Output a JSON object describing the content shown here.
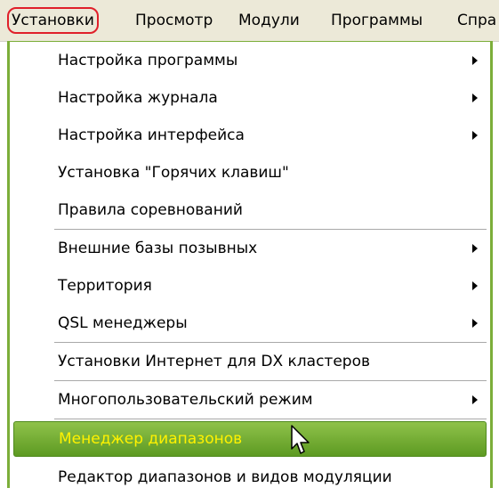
{
  "menubar": {
    "items": [
      {
        "label": "Установки",
        "active": true
      },
      {
        "label": "Просмотр"
      },
      {
        "label": "Модули"
      },
      {
        "label": "Программы"
      },
      {
        "label": "Спра"
      }
    ]
  },
  "menu": {
    "items": [
      {
        "label": "Настройка программы",
        "submenu": true
      },
      {
        "label": "Настройка журнала",
        "submenu": true
      },
      {
        "label": "Настройка интерфейса",
        "submenu": true
      },
      {
        "label": "Установка \"Горячих клавиш\"",
        "submenu": false
      },
      {
        "label": "Правила соревнований",
        "submenu": false
      },
      {
        "label": "Внешние базы позывных",
        "submenu": true
      },
      {
        "label": "Территория",
        "submenu": true
      },
      {
        "label": "QSL менеджеры",
        "submenu": true
      },
      {
        "label": "Установки Интернет для DX кластеров",
        "submenu": false
      },
      {
        "label": "Многопользовательский режим",
        "submenu": true
      },
      {
        "label": "Менеджер диапазонов",
        "submenu": false,
        "highlighted": true
      },
      {
        "label": "Редактор диапазонов и видов модуляции",
        "submenu": false
      }
    ]
  },
  "colors": {
    "highlight_bg": "#6aa82c",
    "highlight_text": "#fff200",
    "active_outline": "#e0202a"
  }
}
